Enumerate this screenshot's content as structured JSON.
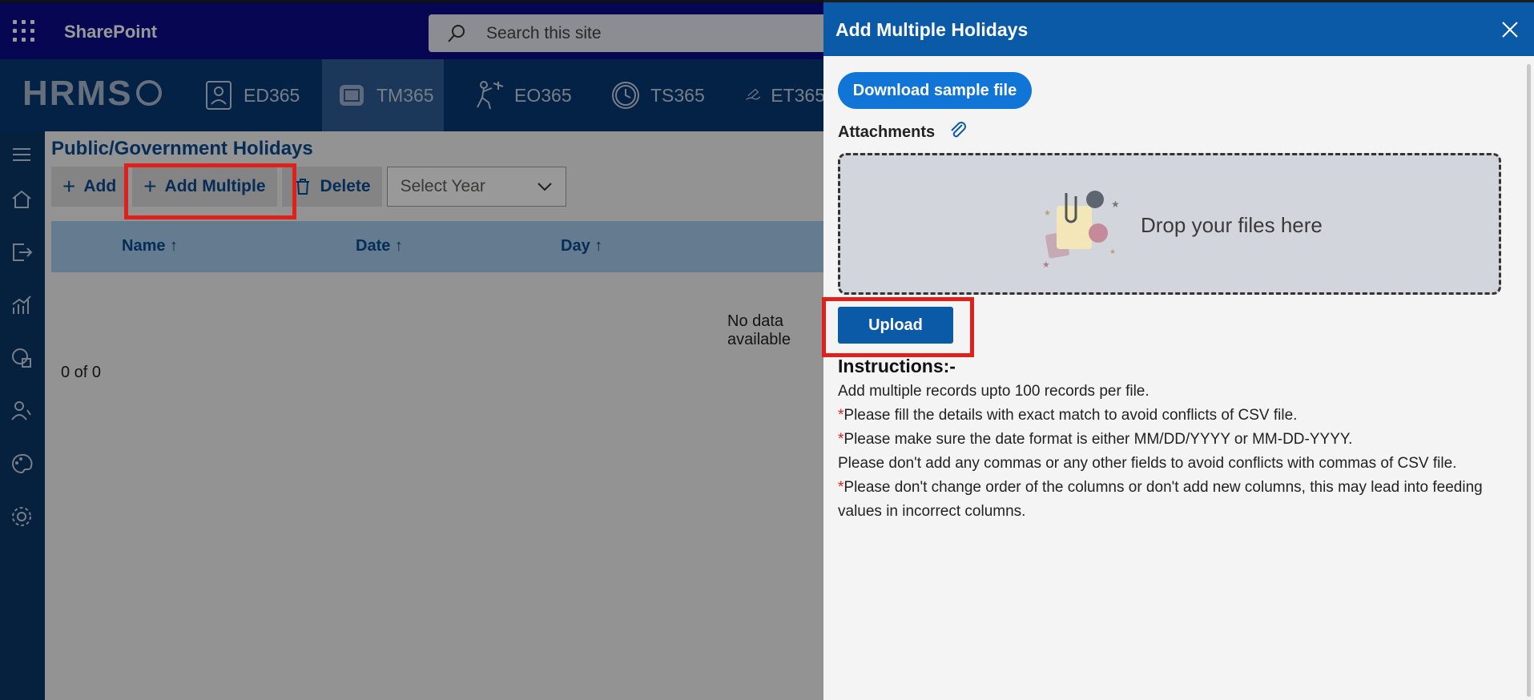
{
  "suite": {
    "app_name": "SharePoint",
    "search_placeholder": "Search this site"
  },
  "hrms": {
    "logo": "HRMS",
    "tabs": [
      {
        "label": "ED365"
      },
      {
        "label": "TM365",
        "active": true
      },
      {
        "label": "EO365"
      },
      {
        "label": "TS365"
      },
      {
        "label": "ET365"
      }
    ]
  },
  "page": {
    "title": "Public/Government Holidays",
    "commands": {
      "add": "Add",
      "add_multiple": "Add Multiple",
      "delete": "Delete",
      "year_placeholder": "Select Year"
    },
    "columns": [
      "Name ↑",
      "Date ↑",
      "Day ↑"
    ],
    "no_data": "No data available",
    "count": "0 of 0"
  },
  "panel": {
    "title": "Add Multiple Holidays",
    "download_label": "Download sample file",
    "attachments_label": "Attachments",
    "drop_text": "Drop your files here",
    "upload_label": "Upload",
    "instructions_title": "Instructions:-",
    "instructions": [
      {
        "required": false,
        "text": "Add multiple records upto 100 records per file."
      },
      {
        "required": true,
        "text": "Please fill the details with exact match to avoid conflicts of CSV file."
      },
      {
        "required": true,
        "text": "Please make sure the date format is either MM/DD/YYYY or MM-DD-YYYY."
      },
      {
        "required": false,
        "text": "Please don't add any commas or any other fields to avoid conflicts with commas of CSV file."
      },
      {
        "required": true,
        "text": "Please don't change order of the columns or don't add new columns, this may lead into feeding values in incorrect columns."
      }
    ],
    "required_marker": "*"
  },
  "colors": {
    "suite_bar": "#0b0b8a",
    "nav_bar": "#063a76",
    "panel_header": "#0b5aa8",
    "highlight": "#e0201b",
    "primary_button": "#1075d7"
  }
}
